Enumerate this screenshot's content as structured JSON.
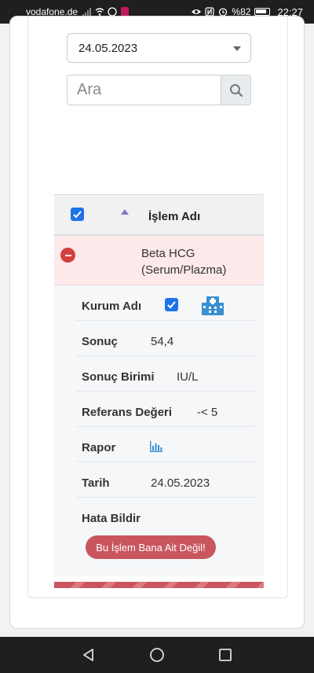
{
  "status_bar": {
    "carrier": "vodafone.de",
    "battery": "%82",
    "time": "22:27"
  },
  "filter": {
    "date_value": "24.05.2023",
    "search_placeholder": "Ara"
  },
  "table": {
    "header_label": "İşlem Adı",
    "row_name": "Beta HCG (Serum/Plazma)"
  },
  "details": {
    "kurum_label": "Kurum Adı",
    "sonuc_label": "Sonuç",
    "sonuc_value": "54,4",
    "birim_label": "Sonuç Birimi",
    "birim_value": "IU/L",
    "referans_label": "Referans Değeri",
    "referans_value": "-< 5",
    "rapor_label": "Rapor",
    "tarih_label": "Tarih",
    "tarih_value": "24.05.2023",
    "hata_label": "Hata Bildir",
    "hata_button": "Bu İşlem Bana Ait Değil!"
  },
  "icons": {
    "hospital": "hospital-icon",
    "chart": "bar-chart-icon",
    "search": "search-icon"
  },
  "colors": {
    "accent": "#1e73e8",
    "danger": "#d23f3f",
    "hata_button": "#c9565f",
    "row_highlight": "#fde8ea"
  }
}
